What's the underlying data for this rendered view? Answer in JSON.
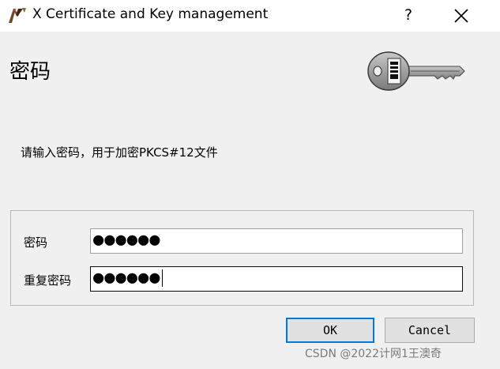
{
  "window": {
    "title": "X Certificate and Key management",
    "help_label": "?"
  },
  "header": {
    "title": "密码"
  },
  "prompt": "请输入密码，用于加密PKCS#12文件",
  "form": {
    "password_label": "密码",
    "password_value": "●●●●●●",
    "repeat_label": "重复密码",
    "repeat_value": "●●●●●●"
  },
  "buttons": {
    "ok": "OK",
    "cancel": "Cancel"
  },
  "watermark": "CSDN @2022计网1王澳奇",
  "icons": {
    "app": "xca-app-icon",
    "key": "key-icon",
    "close": "close-icon"
  },
  "colors": {
    "focus_border": "#0078d7",
    "window_bg": "#f0f0f0"
  }
}
